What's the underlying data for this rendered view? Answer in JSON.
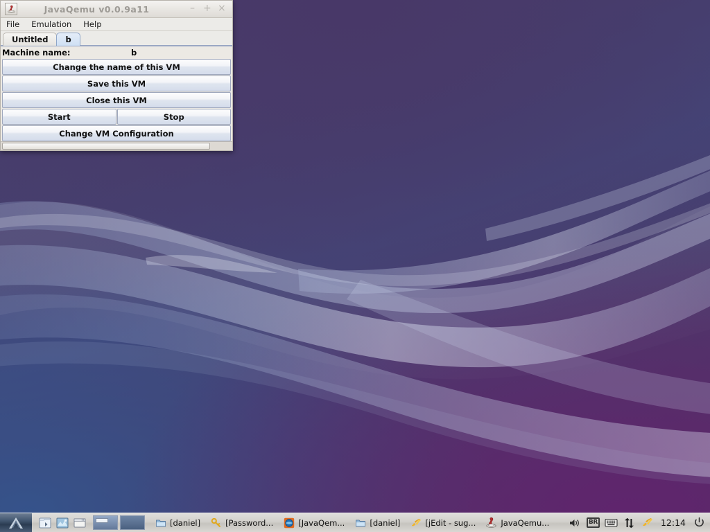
{
  "window": {
    "title": "JavaQemu v0.0.9a11",
    "app_icon": "javaqemu-app-icon",
    "controls": {
      "minimize": "–",
      "maximize": "+",
      "close": "×"
    },
    "menus": [
      "File",
      "Emulation",
      "Help"
    ],
    "tabs": [
      {
        "label": "Untitled",
        "active": false
      },
      {
        "label": "b",
        "active": true
      }
    ],
    "machine": {
      "label": "Machine name:",
      "value": "b"
    },
    "buttons": {
      "change_name": "Change the name of this VM",
      "save": "Save this VM",
      "close": "Close this VM",
      "start": "Start",
      "stop": "Stop",
      "change_config": "Change VM Configuration"
    }
  },
  "taskbar": {
    "start_icon": "start-menu-icon",
    "launchers": [
      {
        "name": "file-manager-icon"
      },
      {
        "name": "image-viewer-icon"
      },
      {
        "name": "terminal-window-icon"
      }
    ],
    "pager": [
      {
        "name": "workspace-1",
        "active": true
      },
      {
        "name": "workspace-2",
        "active": false
      }
    ],
    "tasks": [
      {
        "icon": "folder-icon",
        "label": "[daniel]"
      },
      {
        "icon": "key-icon",
        "label": "[Password..."
      },
      {
        "icon": "browser-icon",
        "label": "[JavaQem..."
      },
      {
        "icon": "folder-icon",
        "label": "[daniel]"
      },
      {
        "icon": "jedit-icon",
        "label": "[jEdit - sug..."
      },
      {
        "icon": "javaqemu-icon",
        "label": "JavaQemu..."
      }
    ],
    "tray": [
      {
        "name": "volume-icon"
      },
      {
        "name": "keyboard-layout-badge",
        "text": "BR"
      },
      {
        "name": "keyboard-icon"
      },
      {
        "name": "network-activity-icon"
      },
      {
        "name": "jedit-tray-icon"
      }
    ],
    "clock": "12:14",
    "power_icon": "power-icon"
  },
  "colors": {
    "desktop_purple": "#4a3a66",
    "desktop_blue": "#3a5080",
    "desktop_magenta": "#53305f",
    "window_face": "#ece9e4",
    "tab_active": "#cfe0f4",
    "button_face": "#dfe5ef",
    "taskbar": "#d2d0cc"
  }
}
